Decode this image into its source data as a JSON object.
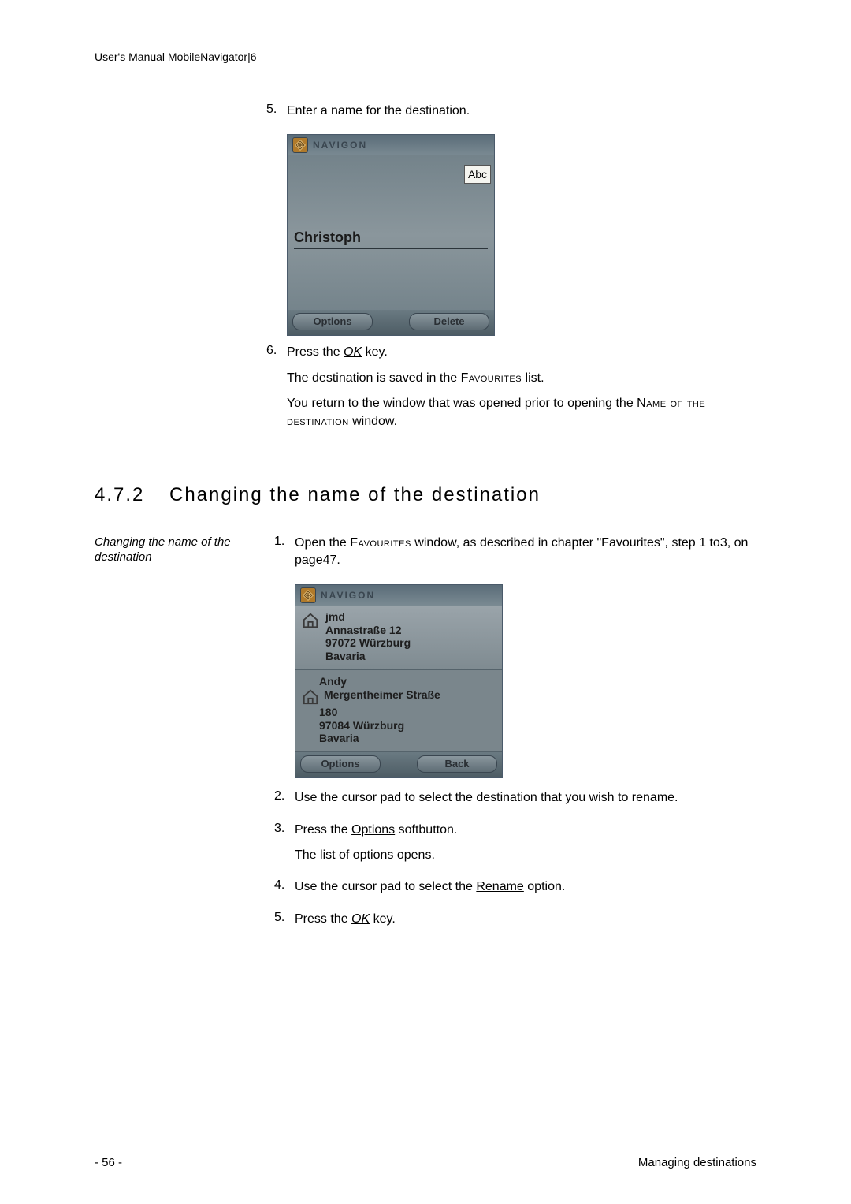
{
  "header": "User's Manual MobileNavigator|6",
  "before_steps": {
    "s5": {
      "num": "5.",
      "text": "Enter a name for the destination."
    },
    "s6": {
      "num": "6.",
      "line1_pre": "Press the ",
      "line1_key": "OK",
      "line1_post": " key.",
      "line2_pre": "The destination is saved in the ",
      "line2_sc": "Favourites",
      "line2_post": " list.",
      "line3_pre": "You return to the window that was opened prior to opening the ",
      "line3_sc": "Name of the destination",
      "line3_post": " window."
    }
  },
  "mock1": {
    "brand": "NAVIGON",
    "input_mode": "Abc",
    "entered_name": "Christoph",
    "btn_options": "Options",
    "btn_delete": "Delete"
  },
  "section": {
    "num": "4.7.2",
    "title": "Changing the name of the destination"
  },
  "side_label": "Changing the name of the destination",
  "s472": {
    "s1": {
      "num": "1.",
      "pre": "Open the ",
      "sc": "Favourites",
      "post": " window, as described in chapter \"Favourites\", step 1 to3, on page47."
    },
    "s2": {
      "num": "2.",
      "text": "Use the cursor pad to select the destination that you wish to rename."
    },
    "s3": {
      "num": "3.",
      "pre": "Press the ",
      "ul": "Options",
      "post": " softbutton.",
      "extra": "The list of options opens."
    },
    "s4": {
      "num": "4.",
      "pre": "Use the cursor pad to select the ",
      "ul": "Rename",
      "post": " option."
    },
    "s5": {
      "num": "5.",
      "pre": "Press the ",
      "key": "OK",
      "post": " key."
    }
  },
  "mock2": {
    "brand": "NAVIGON",
    "items": [
      {
        "name": "jmd",
        "l1": "Annastraße 12",
        "l2": "97072 Würzburg",
        "l3": "Bavaria"
      },
      {
        "name": "Andy",
        "l1": "Mergentheimer Straße",
        "l1b": "180",
        "l2": "97084 Würzburg",
        "l3": "Bavaria"
      }
    ],
    "btn_options": "Options",
    "btn_back": "Back"
  },
  "footer": {
    "page": "- 56 -",
    "chapter": "Managing destinations"
  }
}
